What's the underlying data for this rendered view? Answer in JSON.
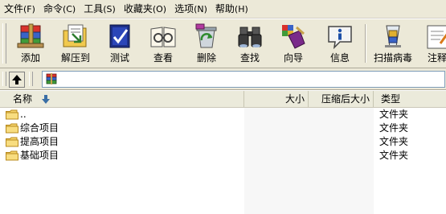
{
  "menu": [
    {
      "label": "文件",
      "accel": "(F)"
    },
    {
      "label": "命令",
      "accel": "(C)"
    },
    {
      "label": "工具",
      "accel": "(S)"
    },
    {
      "label": "收藏夹",
      "accel": "(O)"
    },
    {
      "label": "选项",
      "accel": "(N)"
    },
    {
      "label": "帮助",
      "accel": "(H)"
    }
  ],
  "toolbar": {
    "add": "添加",
    "extract_to": "解压到",
    "test": "测试",
    "view": "查看",
    "delete": "删除",
    "find": "查找",
    "wizard": "向导",
    "info": "信息",
    "virus_scan": "扫描病毒",
    "comment": "注释"
  },
  "columns": {
    "name": "名称",
    "size": "大小",
    "packed": "压缩后大小",
    "type": "类型"
  },
  "files": [
    {
      "name": "..",
      "type": "文件夹"
    },
    {
      "name": "综合项目",
      "type": "文件夹"
    },
    {
      "name": "提高项目",
      "type": "文件夹"
    },
    {
      "name": "基础项目",
      "type": "文件夹"
    }
  ],
  "icons": {
    "up": "up-arrow-icon",
    "sort": "sort-down-icon",
    "folder": "folder-icon",
    "archive": "winrar-archive-icon"
  },
  "colors": {
    "chrome": "#ece9d8",
    "folder": "#f5d36a",
    "sort_arrow": "#3a6ea5"
  }
}
